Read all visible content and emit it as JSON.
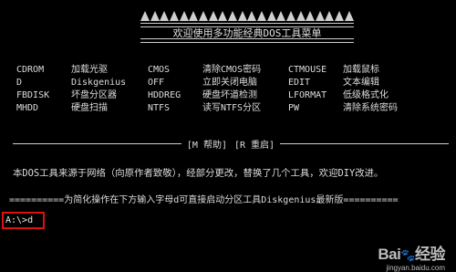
{
  "header": {
    "triangle_count": 22,
    "title": "欢迎使用多功能经典DOS工具菜单"
  },
  "menu": {
    "rows": [
      [
        "CDROM",
        "加载光驱",
        "CMOS",
        "清除CMOS密码",
        "CTMOUSE",
        "加载鼠标"
      ],
      [
        "D",
        "Diskgenius",
        "OFF",
        "立即关闭电脑",
        "EDIT",
        "文本编辑"
      ],
      [
        "FBDISK",
        "坏盘分区器",
        "HDDREG",
        "硬盘坏道检测",
        "LFORMAT",
        "低级格式化"
      ],
      [
        "MHDD",
        "硬盘扫描",
        "NTFS",
        "读写NTFS分区",
        "PW",
        "清除系统密码"
      ]
    ]
  },
  "divider": {
    "help": "[M 帮助]",
    "reboot": "[R 重启]"
  },
  "note": "本DOS工具来源于网络（向原作者致敬），经部分更改，替换了几个工具，欢迎DIY改进。",
  "tip": "==========为简化操作在下方输入字母d可直接启动分区工具Diskgenius最新版==========",
  "prompt": "A:\\>d",
  "watermark": {
    "logo": "Bai",
    "logo_paw": "🐾",
    "logo_tail": "经验",
    "url": "jingyan.baidu.com"
  },
  "colors": {
    "background": "#000000",
    "text": "#d8d8d8",
    "highlight_box": "#e01010"
  }
}
